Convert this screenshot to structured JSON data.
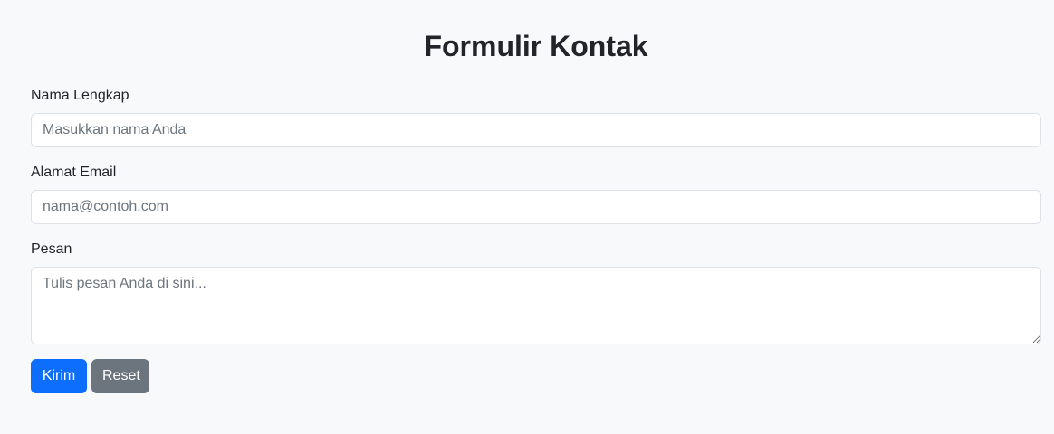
{
  "form": {
    "title": "Formulir Kontak",
    "name": {
      "label": "Nama Lengkap",
      "placeholder": "Masukkan nama Anda",
      "value": ""
    },
    "email": {
      "label": "Alamat Email",
      "placeholder": "nama@contoh.com",
      "value": ""
    },
    "message": {
      "label": "Pesan",
      "placeholder": "Tulis pesan Anda di sini...",
      "value": ""
    },
    "submit_label": "Kirim",
    "reset_label": "Reset"
  },
  "colors": {
    "background": "#f8f9fa",
    "primary": "#0d6efd",
    "secondary": "#6c757d",
    "border": "#dee2e6",
    "text": "#212529"
  }
}
